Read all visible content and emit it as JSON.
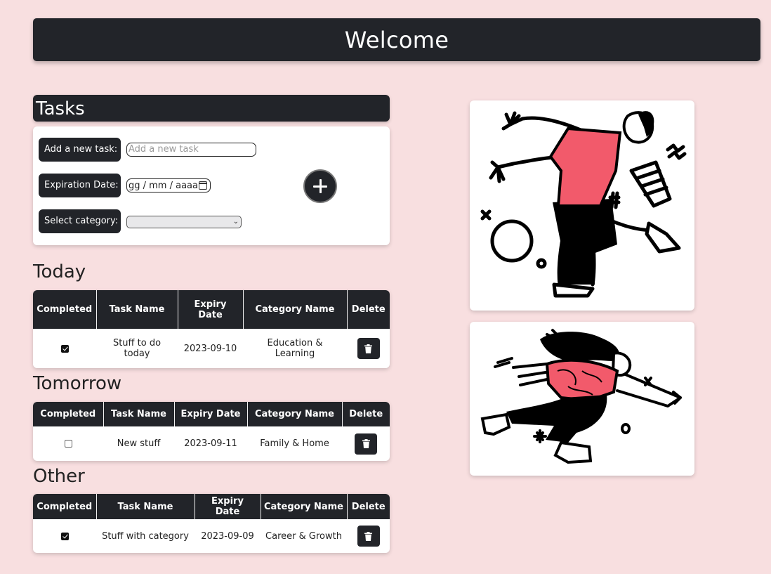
{
  "header": {
    "title": "Welcome"
  },
  "tasks_section": {
    "title": "Tasks",
    "add_task_label": "Add a new task:",
    "add_task_placeholder": "Add a new task",
    "expiration_label": "Expiration Date:",
    "date_placeholder": "gg / mm / aaaa",
    "category_label": "Select category:",
    "category_value": ""
  },
  "groups": [
    {
      "title": "Today",
      "columns": [
        "Completed",
        "Task Name",
        "Expiry Date",
        "Category Name",
        "Delete"
      ],
      "rows": [
        {
          "completed": true,
          "task_name": "Stuff to do today",
          "expiry_date": "2023-09-10",
          "category": "Education & Learning"
        }
      ]
    },
    {
      "title": "Tomorrow",
      "columns": [
        "Completed",
        "Task Name",
        "Expiry Date",
        "Category Name",
        "Delete"
      ],
      "rows": [
        {
          "completed": false,
          "task_name": "New stuff",
          "expiry_date": "2023-09-11",
          "category": "Family & Home"
        }
      ]
    },
    {
      "title": "Other",
      "columns": [
        "Completed",
        "Task Name",
        "Expiry Date",
        "Category Name",
        "Delete"
      ],
      "rows": [
        {
          "completed": true,
          "task_name": "Stuff with category",
          "expiry_date": "2023-09-09",
          "category": "Career & Growth"
        }
      ]
    }
  ],
  "icons": {
    "add": "plus-icon",
    "delete": "trash-icon",
    "calendar": "calendar-icon",
    "select": "chevron-down-icon"
  },
  "colors": {
    "background": "#f8dfe0",
    "dark": "#222429",
    "accent": "#f25a6b"
  }
}
